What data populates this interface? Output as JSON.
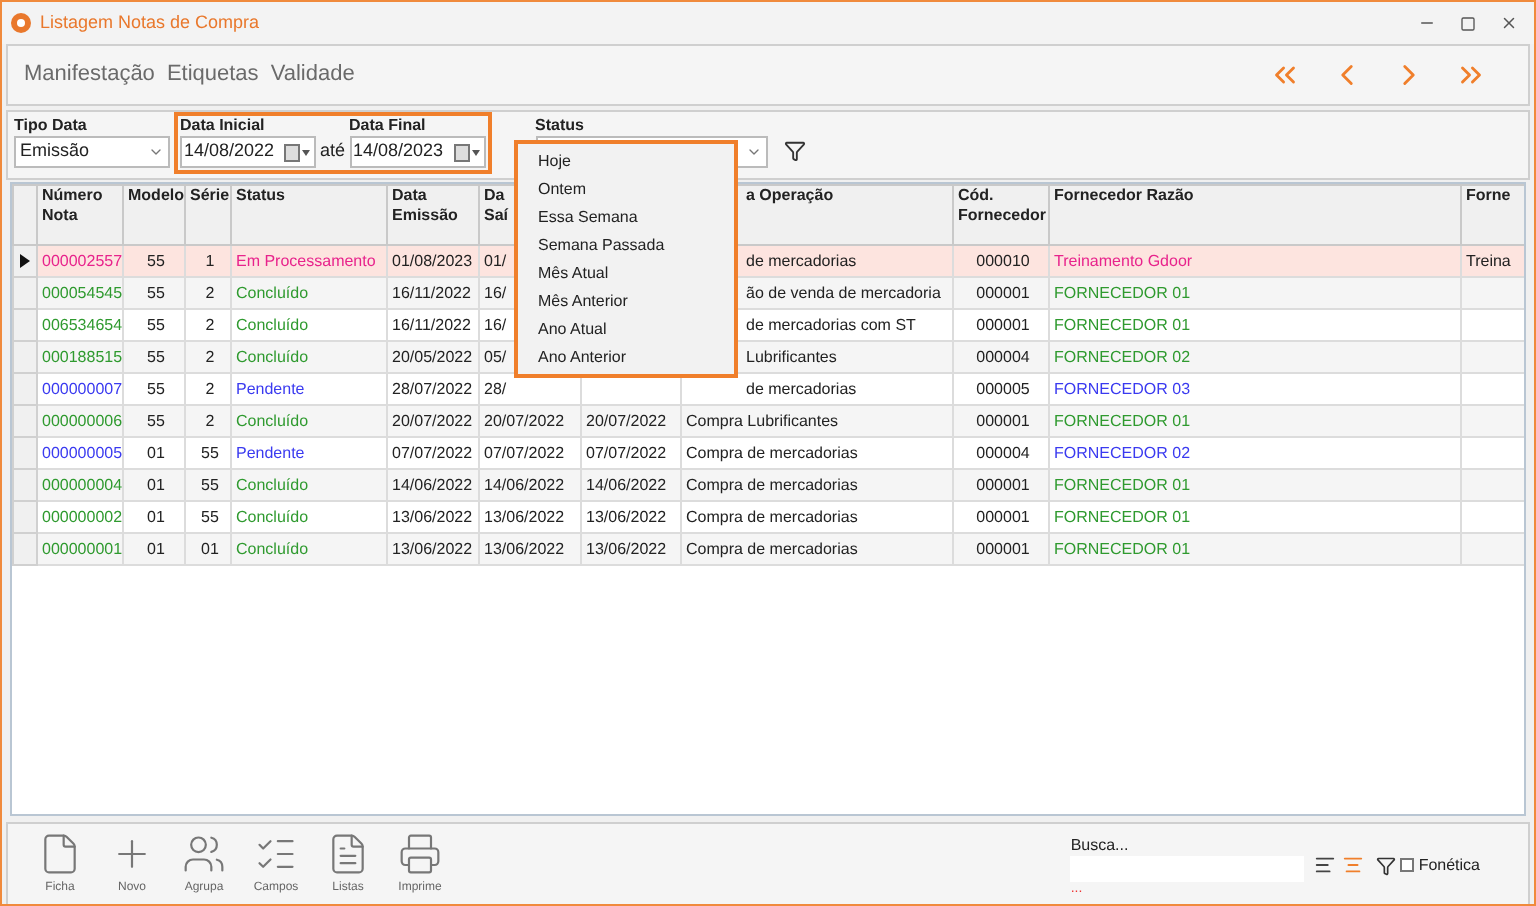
{
  "window": {
    "title": "Listagem Notas de Compra"
  },
  "menu": [
    "Manifestação",
    "Etiquetas",
    "Validade"
  ],
  "filters": {
    "tipo_data": {
      "label": "Tipo Data",
      "value": "Emissão"
    },
    "data_inicial": {
      "label": "Data Inicial",
      "value": "14/08/2022"
    },
    "separator": "até",
    "data_final": {
      "label": "Data Final",
      "value": "14/08/2023"
    },
    "status": {
      "label": "Status"
    }
  },
  "date_menu": [
    "Hoje",
    "Ontem",
    "Essa Semana",
    "Semana Passada",
    "Mês Atual",
    "Mês Anterior",
    "Ano Atual",
    "Ano Anterior"
  ],
  "table": {
    "columns": [
      "Número\nNota",
      "Modelo",
      "Série",
      "Status",
      "Data\nEmissão",
      "Da\nSaí",
      null,
      "a Operação",
      "Cód.\nFornecedor",
      "Fornecedor Razão",
      "Forne"
    ],
    "rows": [
      {
        "selected": true,
        "color": "#e8238c",
        "cells": [
          "000002557",
          "55",
          "1",
          "Em Processamento",
          "01/08/2023",
          "01/",
          null,
          "de mercadorias",
          "000010",
          "Treinamento Gdoor",
          "Treina"
        ]
      },
      {
        "selected": false,
        "color": "#2f9a2f",
        "cells": [
          "000054545",
          "55",
          "2",
          "Concluído",
          "16/11/2022",
          "16/",
          null,
          "ão de venda de mercadoria",
          "000001",
          "FORNECEDOR 01"
        ]
      },
      {
        "selected": false,
        "color": "#2f9a2f",
        "cells": [
          "006534654",
          "55",
          "2",
          "Concluído",
          "16/11/2022",
          "16/",
          null,
          "de mercadorias com ST",
          "000001",
          "FORNECEDOR 01"
        ]
      },
      {
        "selected": false,
        "color": "#2f9a2f",
        "cells": [
          "000188515",
          "55",
          "2",
          "Concluído",
          "20/05/2022",
          "05/",
          null,
          "Lubrificantes",
          "000004",
          "FORNECEDOR 02"
        ]
      },
      {
        "selected": false,
        "color": "#3a3af0",
        "cells": [
          "000000007",
          "55",
          "2",
          "Pendente",
          "28/07/2022",
          "28/",
          null,
          "de mercadorias",
          "000005",
          "FORNECEDOR 03"
        ]
      },
      {
        "selected": false,
        "color": "#2f9a2f",
        "cells": [
          "000000006",
          "55",
          "2",
          "Concluído",
          "20/07/2022",
          "20/07/2022",
          "20/07/2022",
          "Compra Lubrificantes",
          "000001",
          "FORNECEDOR 01"
        ]
      },
      {
        "selected": false,
        "color": "#3a3af0",
        "cells": [
          "000000005",
          "01",
          "55",
          "Pendente",
          "07/07/2022",
          "07/07/2022",
          "07/07/2022",
          "Compra de mercadorias",
          "000004",
          "FORNECEDOR 02"
        ]
      },
      {
        "selected": false,
        "color": "#2f9a2f",
        "cells": [
          "000000004",
          "01",
          "55",
          "Concluído",
          "14/06/2022",
          "14/06/2022",
          "14/06/2022",
          "Compra de mercadorias",
          "000001",
          "FORNECEDOR 01"
        ]
      },
      {
        "selected": false,
        "color": "#2f9a2f",
        "cells": [
          "000000002",
          "01",
          "55",
          "Concluído",
          "13/06/2022",
          "13/06/2022",
          "13/06/2022",
          "Compra de mercadorias",
          "000001",
          "FORNECEDOR 01"
        ]
      },
      {
        "selected": false,
        "color": "#2f9a2f",
        "cells": [
          "000000001",
          "01",
          "01",
          "Concluído",
          "13/06/2022",
          "13/06/2022",
          "13/06/2022",
          "Compra de mercadorias",
          "000001",
          "FORNECEDOR 01"
        ]
      }
    ]
  },
  "toolbar": [
    {
      "kind": "ficha",
      "label": "Ficha"
    },
    {
      "kind": "novo",
      "label": "Novo"
    },
    {
      "kind": "agrupa",
      "label": "Agrupa"
    },
    {
      "kind": "campos",
      "label": "Campos"
    },
    {
      "kind": "listas",
      "label": "Listas"
    },
    {
      "kind": "imprime",
      "label": "Imprime"
    }
  ],
  "search": {
    "label": "Busca...",
    "hint": "...",
    "fonetica": {
      "label": "Fonética",
      "checked": false
    }
  }
}
